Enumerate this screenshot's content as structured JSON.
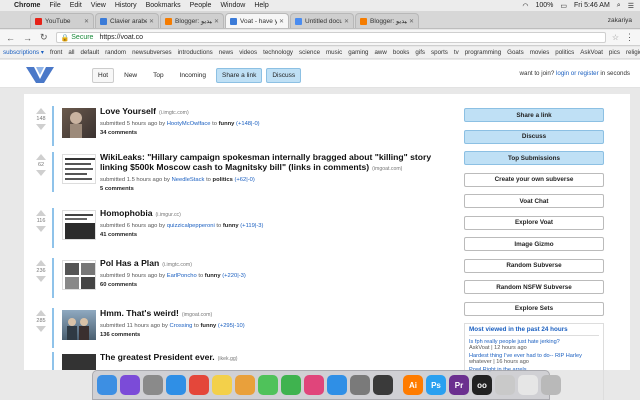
{
  "menubar": {
    "app": "Chrome",
    "items": [
      "File",
      "Edit",
      "View",
      "History",
      "Bookmarks",
      "People",
      "Window",
      "Help"
    ],
    "battery": "100%",
    "time": "Fri 5:46 AM",
    "user": "zakariya"
  },
  "tabs": [
    {
      "title": "YouTube",
      "color": "#e62117"
    },
    {
      "title": "Clavier arabe en ligne",
      "color": "#3b7bd8"
    },
    {
      "title": "Blogger: موسوعة بالفيديو",
      "color": "#f57c00"
    },
    {
      "title": "Voat - have your say",
      "color": "#3b7bd8",
      "active": true
    },
    {
      "title": "Untitled document - G",
      "color": "#4a8cf0"
    },
    {
      "title": "Blogger: موسوعة بالفيديو",
      "color": "#f57c00"
    }
  ],
  "address": {
    "secure_label": "Secure",
    "url": "https://voat.co"
  },
  "subbar": {
    "subscriptions": "subscriptions ▾",
    "items": [
      "front",
      "all",
      "default",
      "random",
      "newsubverses",
      "introductions",
      "news",
      "videos",
      "technology",
      "science",
      "music",
      "gaming",
      "aww",
      "books",
      "gifs",
      "sports",
      "tv",
      "programming",
      "Goats",
      "movies",
      "politics",
      "AskVoat",
      "pics",
      "religion",
      "athe"
    ]
  },
  "header": {
    "nav": [
      "Hot",
      "New",
      "Top",
      "Incoming"
    ],
    "share_link": "Share a link",
    "discuss": "Discuss",
    "want_to_join": "want to join?",
    "login_text": "login or register",
    "seconds": "in seconds"
  },
  "posts": [
    {
      "votes": "148",
      "title": "Love Yourself",
      "domain": "(i.imgtc.com)",
      "submitted": "submitted 5 hours ago by",
      "user": "HootyMcOwlface",
      "to": "to",
      "sub": "funny",
      "score": "(+148|-0)",
      "comments": "34 comments"
    },
    {
      "votes": "62",
      "title": "WikiLeaks: \"Hillary campaign spokesman internally bragged about \"killing\" story linking $500k Moscow cash to Magnitsky bill\" (links in comments)",
      "domain": "(imgoat.com)",
      "submitted": "submitted 1.5 hours ago by",
      "user": "NeedleStack",
      "to": "to",
      "sub": "politics",
      "score": "(+62|-0)",
      "comments": "5 comments"
    },
    {
      "votes": "116",
      "title": "Homophobia",
      "domain": "(i.imgur.cc)",
      "submitted": "submitted 6 hours ago by",
      "user": "quizzicalpepperoni",
      "to": "to",
      "sub": "funny",
      "score": "(+119|-3)",
      "comments": "41 comments"
    },
    {
      "votes": "236",
      "title": "Pol Has a Plan",
      "domain": "(i.imgtc.com)",
      "submitted": "submitted 9 hours ago by",
      "user": "EarlPoncho",
      "to": "to",
      "sub": "funny",
      "score": "(+220|-3)",
      "comments": "60 comments"
    },
    {
      "votes": "285",
      "title": "Hmm. That's weird!",
      "domain": "(imgoat.com)",
      "submitted": "submitted 11 hours ago by",
      "user": "Crossing",
      "to": "to",
      "sub": "funny",
      "score": "(+295|-10)",
      "comments": "136 comments"
    },
    {
      "votes": "",
      "title": "The greatest President ever.",
      "domain": "(ikek.gg)",
      "submitted": "",
      "user": "",
      "to": "",
      "sub": "",
      "score": "",
      "comments": ""
    }
  ],
  "sidebar": {
    "buttons": [
      "Share a link",
      "Discuss",
      "Top Submissions",
      "Create your own subverse",
      "Voat Chat",
      "Explore Voat",
      "Image Gizmo",
      "Random Subverse",
      "Random NSFW Subverse",
      "Explore Sets"
    ],
    "most_viewed_title": "Most viewed in the past 24 hours",
    "most_viewed": [
      {
        "link": "Is fph really people just hate jerking?",
        "meta": "AskVoat | 12 hours ago"
      },
      {
        "link": "Hardest thing I've ever had to do-- RIP Harley",
        "meta": "whatever | 16 hours ago"
      },
      {
        "link": "Powl Right in the arrels.",
        "meta": ""
      }
    ]
  },
  "dock": [
    {
      "name": "finder-icon",
      "color": "#3d8fe3"
    },
    {
      "name": "siri-icon",
      "color": "#7b4bd8"
    },
    {
      "name": "launchpad-icon",
      "color": "#8a8a8a"
    },
    {
      "name": "safari-icon",
      "color": "#2f8fe6"
    },
    {
      "name": "chrome-icon",
      "color": "#e4473a"
    },
    {
      "name": "notes-icon",
      "color": "#f3d04a"
    },
    {
      "name": "photos-icon",
      "color": "#e9a03b"
    },
    {
      "name": "messages-icon",
      "color": "#4fc25a"
    },
    {
      "name": "facetime-icon",
      "color": "#3fb34f"
    },
    {
      "name": "itunes-icon",
      "color": "#e0457b"
    },
    {
      "name": "appstore-icon",
      "color": "#2f8fe6"
    },
    {
      "name": "preferences-icon",
      "color": "#7a7a7a"
    },
    {
      "name": "photoshop-extra-icon",
      "color": "#3a3a3a"
    },
    {
      "name": "illustrator-icon",
      "color": "#ff7c00",
      "label": "Ai"
    },
    {
      "name": "photoshop-icon",
      "color": "#2aa0f0",
      "label": "Ps"
    },
    {
      "name": "premiere-icon",
      "color": "#6b2f8f",
      "label": "Pr"
    },
    {
      "name": "flickr-icon",
      "color": "#222222",
      "label": "oo"
    },
    {
      "name": "preview-icon",
      "color": "#c9c9c9"
    },
    {
      "name": "document-icon",
      "color": "#e6e6e6"
    },
    {
      "name": "trash-icon",
      "color": "#b9b9b9"
    }
  ]
}
